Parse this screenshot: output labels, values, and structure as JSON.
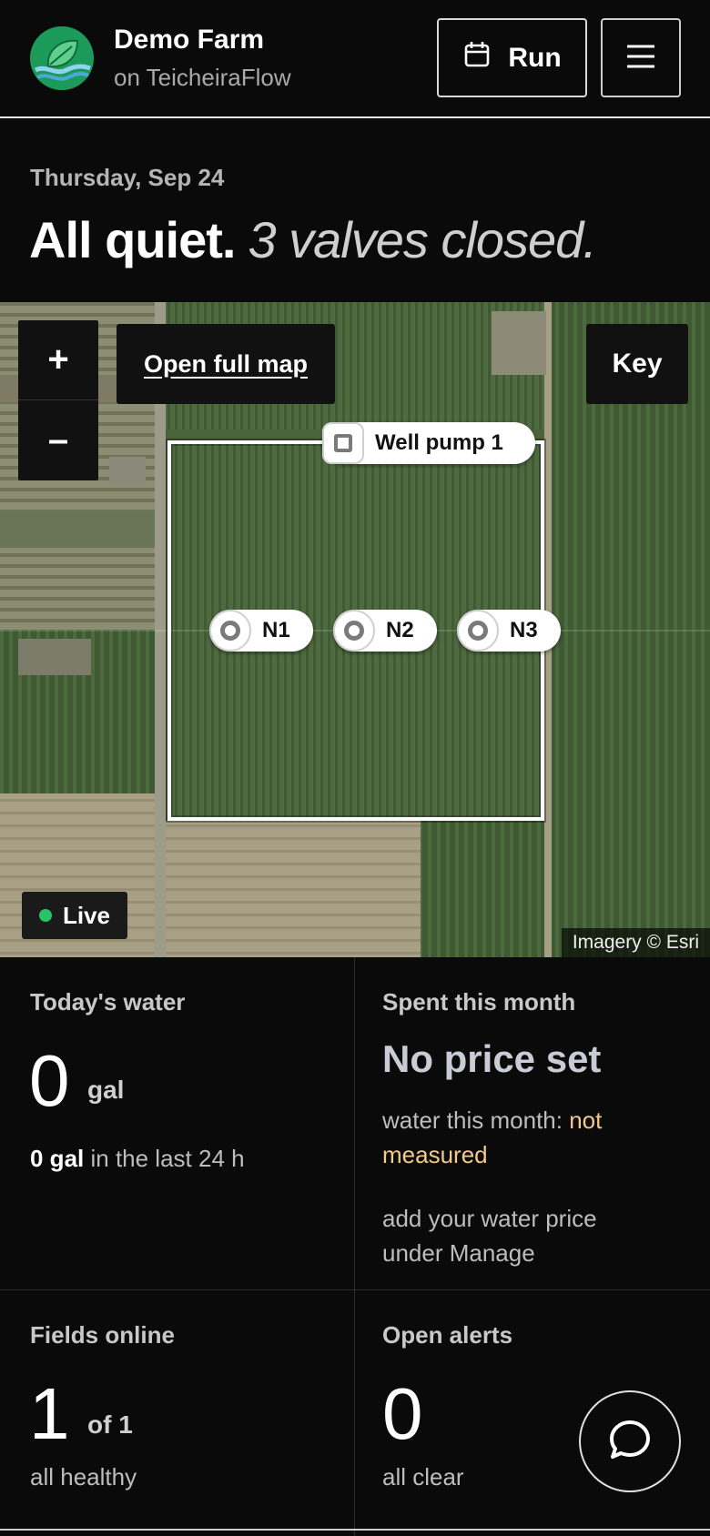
{
  "header": {
    "farm_name": "Demo Farm",
    "platform": "on TeicheiraFlow",
    "run_label": "Run"
  },
  "summary": {
    "date": "Thursday, Sep 24",
    "status": "All quiet.",
    "status_detail": "3 valves closed."
  },
  "map": {
    "zoom_in": "+",
    "zoom_out": "–",
    "open_full_map": "Open full map",
    "key": "Key",
    "pump_label": "Well pump 1",
    "nodes": [
      "N1",
      "N2",
      "N3"
    ],
    "live": "Live",
    "attribution": "Imagery © Esri"
  },
  "stats": {
    "water": {
      "label": "Today's water",
      "value": "0",
      "unit": "gal",
      "last_24_value": "0 gal",
      "last_24_text": "in the last 24 h"
    },
    "spent": {
      "label": "Spent this month",
      "value": "No price set",
      "water_prefix": "water this month:",
      "water_status": "not measured",
      "hint": "add your water price under Manage"
    },
    "fields": {
      "label": "Fields online",
      "value": "1",
      "unit": "of 1",
      "note": "all healthy"
    },
    "alerts": {
      "label": "Open alerts",
      "value": "0",
      "note": "all clear"
    }
  },
  "colors": {
    "accent_green": "#1c9a59",
    "live_dot": "#29c268",
    "warning": "#f4c98a"
  }
}
